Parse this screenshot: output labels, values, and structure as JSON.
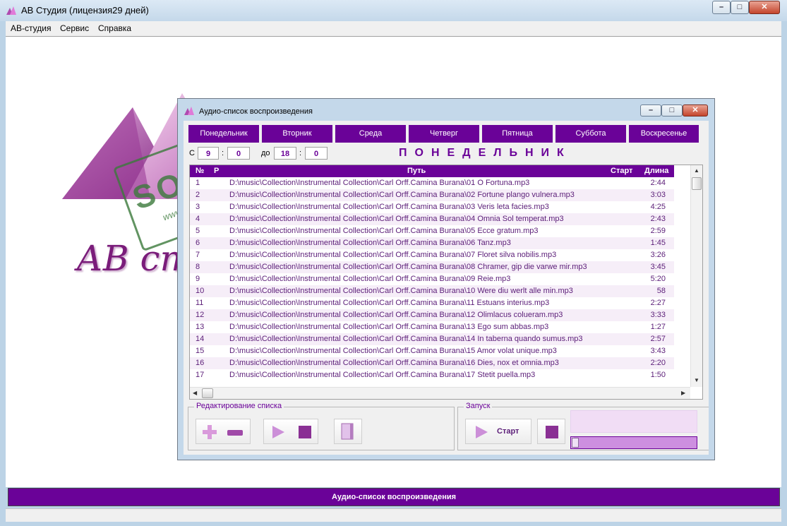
{
  "app": {
    "title": "АВ Студия (лицензия29 дней)",
    "menu": [
      "АВ-студия",
      "Сервис",
      "Справка"
    ],
    "logo_text": "АВ студ",
    "watermark_main": "SOFTPORTAL",
    "watermark_sub": "www.softportal.com",
    "status_text": "Аудио-список воспроизведения",
    "accent_color": "#6a0298"
  },
  "playlist_window": {
    "title": "Аудио-список воспроизведения",
    "days": [
      "Понедельник",
      "Вторник",
      "Среда",
      "Четверг",
      "Пятница",
      "Суббота",
      "Воскресенье"
    ],
    "active_day": "Понедельник",
    "time": {
      "from_label": "С",
      "from_hour": "9",
      "from_min": "0",
      "to_label": "до",
      "to_hour": "18",
      "to_min": "0",
      "sep": ":"
    },
    "day_heading": "ПОНЕДЕЛЬНИК",
    "columns": {
      "num": "№",
      "r": "Р",
      "path": "Путь",
      "start": "Старт",
      "length": "Длина"
    },
    "rows": [
      {
        "n": "1",
        "path": "D:\\music\\Collection\\Instrumental Collection\\Carl Orff.Camina Burana\\01 O Fortuna.mp3",
        "len": "2:44"
      },
      {
        "n": "2",
        "path": "D:\\music\\Collection\\Instrumental Collection\\Carl Orff.Camina Burana\\02 Fortune plango vulnera.mp3",
        "len": "3:03"
      },
      {
        "n": "3",
        "path": "D:\\music\\Collection\\Instrumental Collection\\Carl Orff.Camina Burana\\03 Veris leta facies.mp3",
        "len": "4:25"
      },
      {
        "n": "4",
        "path": "D:\\music\\Collection\\Instrumental Collection\\Carl Orff.Camina Burana\\04 Omnia Sol temperat.mp3",
        "len": "2:43"
      },
      {
        "n": "5",
        "path": "D:\\music\\Collection\\Instrumental Collection\\Carl Orff.Camina Burana\\05 Ecce gratum.mp3",
        "len": "2:59"
      },
      {
        "n": "6",
        "path": "D:\\music\\Collection\\Instrumental Collection\\Carl Orff.Camina Burana\\06 Tanz.mp3",
        "len": "1:45"
      },
      {
        "n": "7",
        "path": "D:\\music\\Collection\\Instrumental Collection\\Carl Orff.Camina Burana\\07 Floret silva nobilis.mp3",
        "len": "3:26"
      },
      {
        "n": "8",
        "path": "D:\\music\\Collection\\Instrumental Collection\\Carl Orff.Camina Burana\\08 Chramer, gip die varwe mir.mp3",
        "len": "3:45"
      },
      {
        "n": "9",
        "path": "D:\\music\\Collection\\Instrumental Collection\\Carl Orff.Camina Burana\\09 Reie.mp3",
        "len": "5:20"
      },
      {
        "n": "10",
        "path": "D:\\music\\Collection\\Instrumental Collection\\Carl Orff.Camina Burana\\10 Were diu werlt alle min.mp3",
        "len": "58"
      },
      {
        "n": "11",
        "path": "D:\\music\\Collection\\Instrumental Collection\\Carl Orff.Camina Burana\\11 Estuans interius.mp3",
        "len": "2:27"
      },
      {
        "n": "12",
        "path": "D:\\music\\Collection\\Instrumental Collection\\Carl Orff.Camina Burana\\12 Olimlacus colueram.mp3",
        "len": "3:33"
      },
      {
        "n": "13",
        "path": "D:\\music\\Collection\\Instrumental Collection\\Carl Orff.Camina Burana\\13 Ego sum abbas.mp3",
        "len": "1:27"
      },
      {
        "n": "14",
        "path": "D:\\music\\Collection\\Instrumental Collection\\Carl Orff.Camina Burana\\14 In taberna quando sumus.mp3",
        "len": "2:57"
      },
      {
        "n": "15",
        "path": "D:\\music\\Collection\\Instrumental Collection\\Carl Orff.Camina Burana\\15 Amor volat unique.mp3",
        "len": "3:43"
      },
      {
        "n": "16",
        "path": "D:\\music\\Collection\\Instrumental Collection\\Carl Orff.Camina Burana\\16 Dies, nox et omnia.mp3",
        "len": "2:20"
      },
      {
        "n": "17",
        "path": "D:\\music\\Collection\\Instrumental Collection\\Carl Orff.Camina Burana\\17 Stetit puella.mp3",
        "len": "1:50"
      }
    ],
    "edit_group_label": "Редактирование списка",
    "run_group_label": "Запуск",
    "start_label": "Старт",
    "progress": 0.02,
    "icons": [
      "add-icon",
      "remove-icon",
      "play-icon",
      "stop-icon",
      "notebook-icon",
      "play-icon",
      "stop-icon"
    ]
  }
}
